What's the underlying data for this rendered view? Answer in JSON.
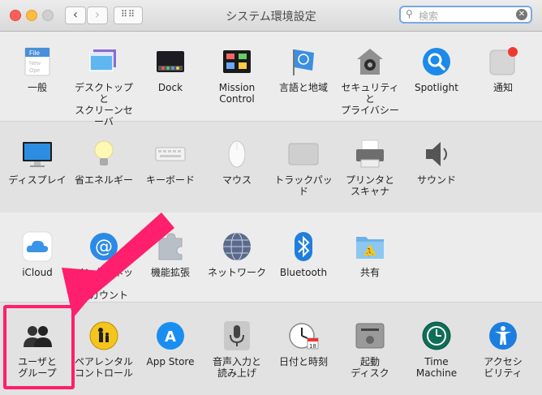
{
  "window": {
    "title": "システム環境設定",
    "search_placeholder": "検索",
    "back_glyph": "‹",
    "forward_glyph": "›",
    "grid_glyph": "⠿⠿"
  },
  "rows": [
    [
      {
        "name": "general",
        "label": "一般",
        "icon": "file-icon"
      },
      {
        "name": "desktop",
        "label": "デスクトップと\nスクリーンセーバ",
        "icon": "desktop-icon"
      },
      {
        "name": "dock",
        "label": "Dock",
        "icon": "dock-icon"
      },
      {
        "name": "mission-control",
        "label": "Mission\nControl",
        "icon": "mission-control-icon"
      },
      {
        "name": "language",
        "label": "言語と地域",
        "icon": "flag-icon"
      },
      {
        "name": "security",
        "label": "セキュリティと\nプライバシー",
        "icon": "house-lock-icon"
      },
      {
        "name": "spotlight",
        "label": "Spotlight",
        "icon": "magnifier-icon"
      },
      {
        "name": "notifications",
        "label": "通知",
        "icon": "notification-icon"
      }
    ],
    [
      {
        "name": "displays",
        "label": "ディスプレイ",
        "icon": "monitor-icon"
      },
      {
        "name": "energy",
        "label": "省エネルギー",
        "icon": "lightbulb-icon"
      },
      {
        "name": "keyboard",
        "label": "キーボード",
        "icon": "keyboard-icon"
      },
      {
        "name": "mouse",
        "label": "マウス",
        "icon": "mouse-icon"
      },
      {
        "name": "trackpad",
        "label": "トラックパッド",
        "icon": "trackpad-icon"
      },
      {
        "name": "printers",
        "label": "プリンタと\nスキャナ",
        "icon": "printer-icon"
      },
      {
        "name": "sound",
        "label": "サウンド",
        "icon": "speaker-icon"
      }
    ],
    [
      {
        "name": "icloud",
        "label": "iCloud",
        "icon": "cloud-icon"
      },
      {
        "name": "internet-accounts",
        "label": "インターネット\nアカウント",
        "icon": "at-icon"
      },
      {
        "name": "extensions",
        "label": "機能拡張",
        "icon": "puzzle-icon"
      },
      {
        "name": "network",
        "label": "ネットワーク",
        "icon": "globe-icon"
      },
      {
        "name": "bluetooth",
        "label": "Bluetooth",
        "icon": "bluetooth-icon"
      },
      {
        "name": "sharing",
        "label": "共有",
        "icon": "folder-icon"
      }
    ],
    [
      {
        "name": "users-groups",
        "label": "ユーザと\nグループ",
        "icon": "users-icon"
      },
      {
        "name": "parental-controls",
        "label": "ペアレンタル\nコントロール",
        "icon": "parental-icon"
      },
      {
        "name": "app-store",
        "label": "App Store",
        "icon": "app-store-icon"
      },
      {
        "name": "dictation",
        "label": "音声入力と\n読み上げ",
        "icon": "microphone-icon"
      },
      {
        "name": "date-time",
        "label": "日付と時刻",
        "icon": "clock-icon"
      },
      {
        "name": "startup-disk",
        "label": "起動\nディスク",
        "icon": "disk-icon"
      },
      {
        "name": "time-machine",
        "label": "Time\nMachine",
        "icon": "time-machine-icon"
      },
      {
        "name": "accessibility",
        "label": "アクセシ\nビリティ",
        "icon": "accessibility-icon"
      }
    ]
  ],
  "calendar_day": "18",
  "annotation": {
    "color": "#ff1f6c",
    "target": "users-groups"
  }
}
